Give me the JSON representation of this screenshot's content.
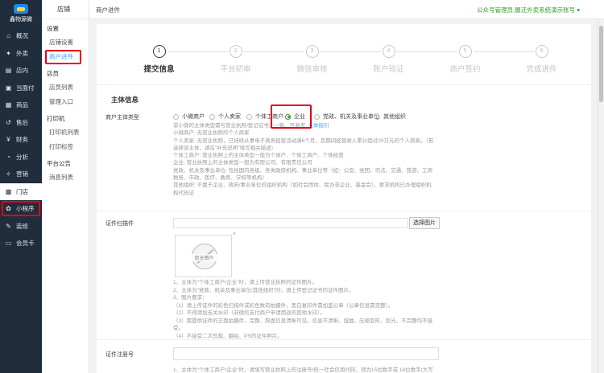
{
  "brand": {
    "name": "鑫物源微"
  },
  "nav": [
    {
      "icon": "home-icon",
      "glyph": "⌂",
      "label": "概况"
    },
    {
      "icon": "takeout-icon",
      "glyph": "✦",
      "label": "外卖"
    },
    {
      "icon": "store-icon",
      "glyph": "▤",
      "label": "店内"
    },
    {
      "icon": "pay-icon",
      "glyph": "▣",
      "label": "当面付"
    },
    {
      "icon": "goods-icon",
      "glyph": "▦",
      "label": "商品"
    },
    {
      "icon": "aftersale-icon",
      "glyph": "↺",
      "label": "售后"
    },
    {
      "icon": "finance-icon",
      "glyph": "¥",
      "label": "财务"
    },
    {
      "icon": "analysis-icon",
      "glyph": "◔",
      "label": "分析"
    },
    {
      "icon": "marketing-icon",
      "glyph": "✧",
      "label": "营销"
    },
    {
      "icon": "shop-icon",
      "glyph": "▩",
      "label": "门店"
    },
    {
      "icon": "miniprogram-icon",
      "glyph": "✿",
      "label": "小程序"
    },
    {
      "icon": "decoration-icon",
      "glyph": "✎",
      "label": "装修"
    },
    {
      "icon": "membercard-icon",
      "glyph": "▭",
      "label": "会员卡"
    }
  ],
  "subnav": {
    "title": "店铺",
    "groups": [
      {
        "label": "设置",
        "items": [
          "店铺设置",
          "商户进件"
        ]
      },
      {
        "label": "店员",
        "items": [
          "店员列表",
          "管理入口"
        ]
      },
      {
        "label": "打印机",
        "items": [
          "打印机列表",
          "打印标签"
        ]
      },
      {
        "label": "平台公告",
        "items": [
          "消息列表"
        ]
      }
    ]
  },
  "topbar": {
    "breadcrumb": "商户进件",
    "account": "公众号管理员:展迁外卖系统演示账号 ▾"
  },
  "steps": [
    {
      "num": "1",
      "label": "提交信息"
    },
    {
      "num": "2",
      "label": "平台初审"
    },
    {
      "num": "3",
      "label": "微信审核"
    },
    {
      "num": "4",
      "label": "账户验证"
    },
    {
      "num": "5",
      "label": "商户签约"
    },
    {
      "num": "6",
      "label": "完成进件"
    }
  ],
  "active_step": 1,
  "section_title": "主体信息",
  "subject_type": {
    "label": "商户主体类型",
    "options": [
      "小微商户",
      "个人卖家",
      "个体工商户",
      "企业",
      "党政、机关及事业单位",
      "其他组织"
    ],
    "selected": "企业"
  },
  "help_lines": [
    "非小微的主体类型需与营业执照/登记证书上一致，可参考",
    "小微商户: 无营业执照的个人商家",
    "个人卖家: 无营业执照，已持续从事电子商务经营活动满6个月，且期间经营收入累计超过20万元的个人商家。（若",
    "选择该主体，请在\"补充说明\"填写相关描述）",
    "个体工商户: 营业执照上的主体类型一般为个体户、个体工商户、个体经营",
    "企业: 营业执照上的主体类型一般为有限公司、有限责任公司",
    "党政、机关及事业单位: 包括国内各级、各类政府机构、事业单位等（如：公安、党团、司法、交通、旅游、工商",
    "税务、市政、医疗、教育、学校等机构）",
    "其他组织: 不属于企业、政府/事业单位的组织机构（如社会团体、民办非企业、基金会），要求机构已办理组织机",
    "构代码证"
  ],
  "help_link": "主体指引",
  "cert_scan": {
    "label": "证件扫描件",
    "button": "选择图片",
    "thumb_caption": "暂无图片",
    "close": "×"
  },
  "cert_tips": [
    "1、主体为\"个体工商户/企业\"时，请上传营业执照的证件图片。",
    "2、主体为\"党政、机关及事业单位/其他组织\"时，请上传登记证书的证件图片。",
    "3、图片要求：",
    "（1）请上传证件的彩色扫描件或彩色数码拍摄件，黑白复印件需加盖公章（公章信息需完整）。",
    "（2）不得添加无关水印（非微信支付商户申请用途的其他水印）。",
    "（3）需提供证件的正面拍摄件，完整、照面信息清晰可见。信息不清晰、扭曲、压缩变形、反光、不完整均不接",
    "受。",
    "（4）不接受二次剪裁、翻拍、PS的证件照片。"
  ],
  "cert_no": {
    "label": "证件注册号",
    "tip": "1、主体为\"个体工商户/企业\"时，请填写营业执照上的注册号/统一社会信用代码，须为15位数字或 18位数字(大写"
  }
}
